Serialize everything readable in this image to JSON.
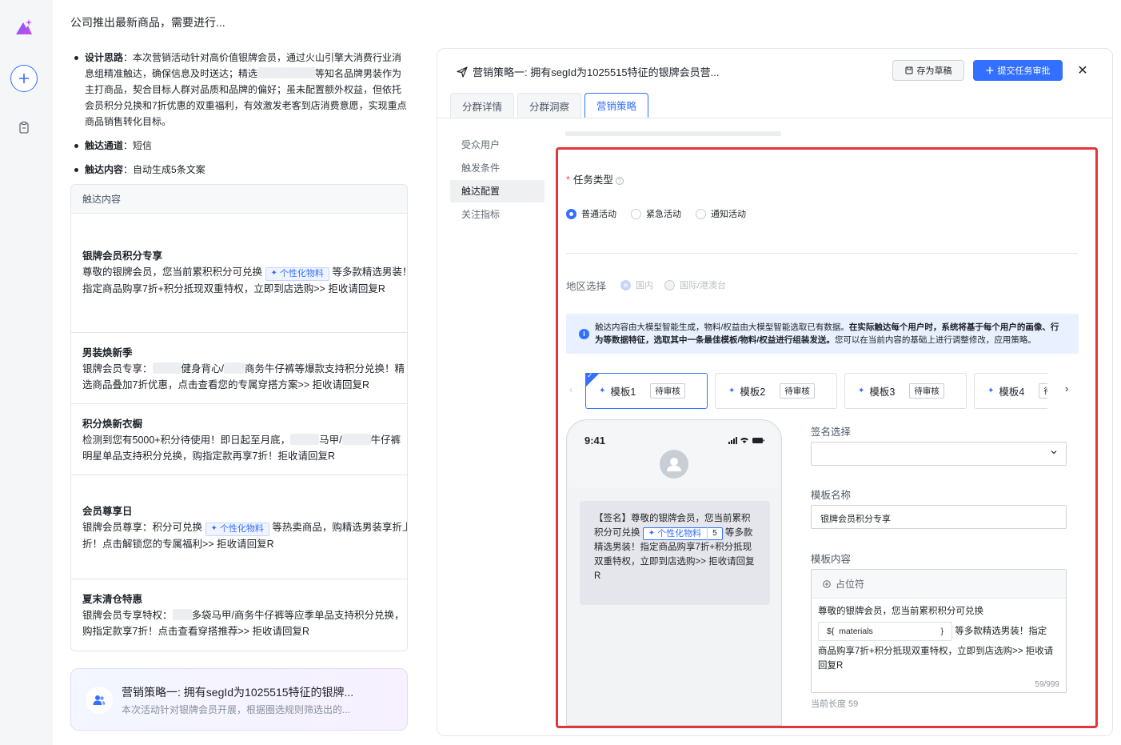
{
  "chat": {
    "title": "公司推出最新商品，需要进行...",
    "bullets": [
      {
        "label": "设计思路",
        "text": "：本次营销活动针对高价值银牌会员，通过火山引擎大消费行业消息组精准触达，确保信息及时送达；精选",
        "text2": "等知名品牌男装作为主打商品，契合目标人群对品质和品牌的偏好；虽未配置额外权益，但依托会员积分兑换和7折优惠的双重福利，有效激发老客到店消费意愿，实现重点商品销售转化目标。"
      },
      {
        "label": "触达通道",
        "text": "：短信"
      },
      {
        "label": "触达内容",
        "text": "：自动生成5条文案"
      }
    ],
    "table_header": "触达内容",
    "messages": [
      {
        "title": "银牌会员积分专享",
        "line1a": "尊敬的银牌会员，您当前累积积分可兑换",
        "chip": "个性化物料",
        "line1b": "等多款精选男装！",
        "line2": "指定商品购享7折+积分抵现双重特权，立即到店选购>> 拒收请回复R"
      },
      {
        "title": "男装焕新季",
        "line1a": "银牌会员专享：",
        "line1b": "健身背心/",
        "line1c": "商务牛仔裤等爆款支持积分兑换！精",
        "line2": "选商品叠加7折优惠，点击查看您的专属穿搭方案>> 拒收请回复R"
      },
      {
        "title": "积分焕新衣橱",
        "line1a": "检测到您有5000+积分待使用！即日起至月底，",
        "line1b": "马甲/",
        "line1c": "牛仔裤",
        "line2": "明星单品支持积分兑换，购指定款再享7折！拒收请回复R"
      },
      {
        "title": "会员尊享日",
        "line1a": "银牌会员尊享：积分可兑换",
        "chip": "个性化物料",
        "line1b": "等热卖商品，购精选男装享折上",
        "line2": "折！点击解锁您的专属福利>> 拒收请回复R"
      },
      {
        "title": "夏末清仓特惠",
        "line1a": "银牌会员专享特权：",
        "line1b": "多袋马甲/商务牛仔裤等应季单品支持积分兑换，",
        "line2": "购指定款享7折！点击查看穿搭推荐>> 拒收请回复R"
      }
    ],
    "strategy_card": {
      "title": "营销策略一: 拥有segId为1025515特征的银牌...",
      "desc": "本次活动针对银牌会员开展，根据圈选规则筛选出的..."
    }
  },
  "panel": {
    "title": "营销策略一: 拥有segId为1025515特征的银牌会员营...",
    "draft_label": "存为草稿",
    "submit_label": "提交任务审批",
    "tabs": [
      "分群详情",
      "分群洞察",
      "营销策略"
    ],
    "subnav": [
      "受众用户",
      "触发条件",
      "触达配置",
      "关注指标"
    ],
    "task_type_label": "任务类型",
    "task_types": [
      "普通活动",
      "紧急活动",
      "通知活动"
    ],
    "region_label": "地区选择",
    "regions": [
      "国内",
      "国际/港澳台"
    ],
    "info_text_a": "触达内容由大模型智能生成，物料/权益由大模型智能选取已有数据。",
    "info_text_b": "在实际触达每个用户时，系统将基于每个用户的画像、行为等数据特征，选取其中一条最佳模板/物料/权益进行组装发送。",
    "info_text_c": "您可以在当前内容的基础上进行调整修改，应用策略。",
    "templates": [
      {
        "name": "模板1",
        "status": "待审核"
      },
      {
        "name": "模板2",
        "status": "待审核"
      },
      {
        "name": "模板3",
        "status": "待审核"
      },
      {
        "name": "模板4",
        "status": "待审核"
      }
    ],
    "phone": {
      "time": "9:41",
      "msg_a": "【签名】尊敬的银牌会员，您当前累积积分可兑换",
      "chip": "个性化物料",
      "chip_num": "5",
      "msg_b": "等多款精选男装！指定商品购享7折+积分抵现双重特权，立即到店选购>> 拒收请回复R"
    },
    "signature_label": "签名选择",
    "template_name_label": "模板名称",
    "template_name_value": "银牌会员积分专享",
    "template_content_label": "模板内容",
    "placeholder_btn": "占位符",
    "content_a": "尊敬的银牌会员，您当前累积积分可兑换",
    "var_prefix": "${",
    "var_name": "materials",
    "var_suffix": "}",
    "content_b": "等多款精选男装！指定",
    "content_c": "商品购享7折+积分抵现双重特权，立即到店选购>> 拒收请回复R",
    "counter": "59/999",
    "current_length": "当前长度 59"
  }
}
